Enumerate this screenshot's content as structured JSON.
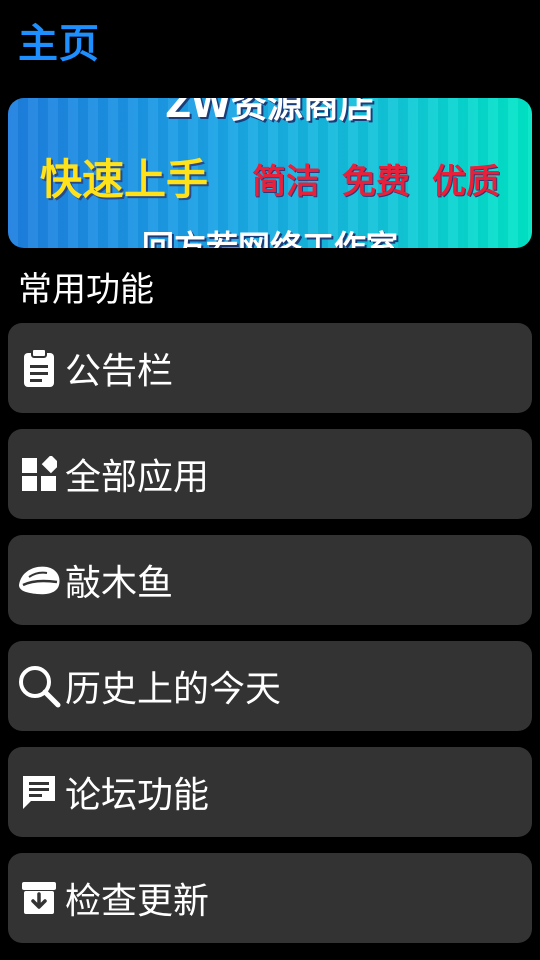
{
  "header": {
    "title": "主页"
  },
  "banner": {
    "top_text": "ZW资源商店",
    "headline": "快速上手",
    "tags": [
      "简洁",
      "免费",
      "优质"
    ],
    "bottom_text": "回方若网络工作室"
  },
  "section": {
    "title": "常用功能"
  },
  "menu": {
    "items": [
      {
        "label": "公告栏",
        "icon": "clipboard-icon"
      },
      {
        "label": "全部应用",
        "icon": "apps-widgets-icon"
      },
      {
        "label": "敲木鱼",
        "icon": "wooden-fish-icon"
      },
      {
        "label": "历史上的今天",
        "icon": "search-icon"
      },
      {
        "label": "论坛功能",
        "icon": "chat-message-icon"
      },
      {
        "label": "检查更新",
        "icon": "download-box-icon"
      }
    ]
  },
  "colors": {
    "title": "#1e8fff",
    "card": "#333333",
    "background": "#000000",
    "banner_yellow": "#ffe21a",
    "banner_red": "#e8203a"
  }
}
